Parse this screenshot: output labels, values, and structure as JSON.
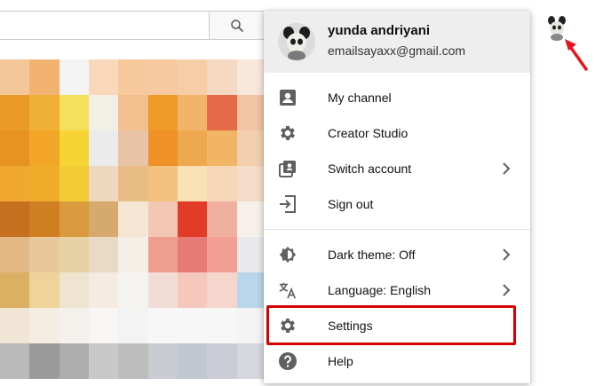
{
  "header": {
    "search_icon": "search-icon",
    "avatar_icon": "account-avatar"
  },
  "account": {
    "name": "yunda andriyani",
    "email": "emailsayaxx@gmail.com"
  },
  "menu": {
    "sections": [
      [
        {
          "label": "My channel",
          "icon": "person-icon",
          "chevron": false
        },
        {
          "label": "Creator Studio",
          "icon": "gear-icon",
          "chevron": false
        },
        {
          "label": "Switch account",
          "icon": "switch-account-icon",
          "chevron": true
        },
        {
          "label": "Sign out",
          "icon": "sign-out-icon",
          "chevron": false
        }
      ],
      [
        {
          "label": "Dark theme: Off",
          "icon": "dark-theme-icon",
          "chevron": true
        },
        {
          "label": "Language: English",
          "icon": "language-icon",
          "chevron": true
        },
        {
          "label": "Settings",
          "icon": "gear-icon",
          "chevron": false
        },
        {
          "label": "Help",
          "icon": "help-icon",
          "chevron": false
        }
      ]
    ]
  },
  "colors": {
    "highlight": "#d40000",
    "arrow": "#e8131b",
    "menu_header_bg": "#eeeeee"
  },
  "mosaic_colors": [
    [
      "#f3c79a",
      "#f1b36f",
      "#f3f3f3",
      "#f8d7bb",
      "#f6c89b",
      "#f8c9a0",
      "#f7cda8",
      "#f6d9c2",
      "#f9e7da"
    ],
    [
      "#ea9b25",
      "#f0b035",
      "#f4e05a",
      "#f2f0e6",
      "#f2c08e",
      "#ee9a27",
      "#f2b46a",
      "#e46a4a",
      "#f1c4a4"
    ],
    [
      "#e69322",
      "#f2a628",
      "#f5d433",
      "#ebebeb",
      "#e9c3a6",
      "#f09128",
      "#eea850",
      "#f1b565",
      "#f2cfae"
    ],
    [
      "#f0a92e",
      "#eeac2b",
      "#f3cb35",
      "#eed7be",
      "#e9bb85",
      "#f2c17f",
      "#f7e2b5",
      "#f6d8b8",
      "#f5dcc8"
    ],
    [
      "#c5701e",
      "#cd7f22",
      "#d99b3e",
      "#d6aa6f",
      "#f4e6d2",
      "#f4c7b5",
      "#e23b27",
      "#f0b0a0",
      "#f5f0ea"
    ],
    [
      "#e4b885",
      "#e8c89b",
      "#e7d2a3",
      "#eadac5",
      "#f4eee6",
      "#ef9d8e",
      "#e67b78",
      "#f19e95",
      "#e9e9ec"
    ],
    [
      "#dcb063",
      "#eed49b",
      "#efe4cf",
      "#f4ece3",
      "#f5f3f0",
      "#f2ddd6",
      "#f6c7bd",
      "#f4d6cc",
      "#bad6ea"
    ],
    [
      "#f1e6d6",
      "#f4ede2",
      "#f4f1ec",
      "#f7f6f4",
      "#f3f3f3",
      "#f7f7f7",
      "#f7f7f7",
      "#f7f7f7",
      "#f4f4f4"
    ],
    [
      "#b9b9b9",
      "#9a9a9a",
      "#adadad",
      "#c8c8c8",
      "#bdbdbd",
      "#c9ccd3",
      "#c2c6cf",
      "#cbcdd6",
      "#d7d8dd"
    ]
  ]
}
